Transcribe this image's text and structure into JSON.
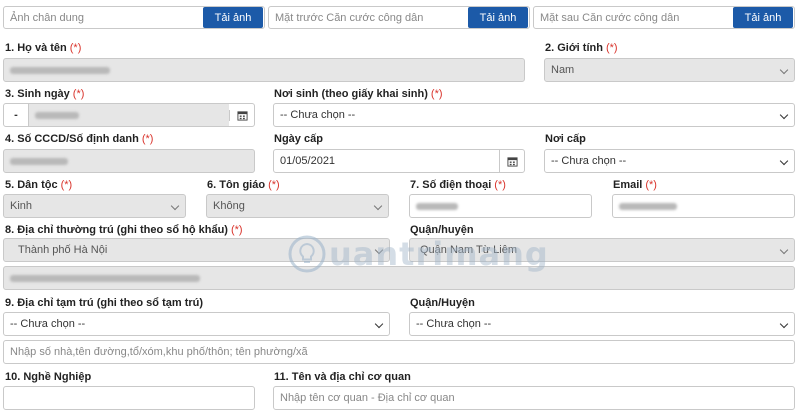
{
  "uploads": [
    {
      "placeholder": "Ảnh chân dung",
      "button": "Tải ảnh"
    },
    {
      "placeholder": "Mặt trước Căn cước công dân",
      "button": "Tải ảnh"
    },
    {
      "placeholder": "Mặt sau Căn cước công dân",
      "button": "Tải ảnh"
    }
  ],
  "required_mark": "(*)",
  "labels": {
    "full_name": "1. Họ và tên",
    "gender": "2. Giới tính",
    "dob": "3. Sinh ngày",
    "birthplace": "Nơi sinh (theo giấy khai sinh)",
    "id_number": "4. Số CCCD/Số định danh",
    "issue_date": "Ngày cấp",
    "issue_place": "Nơi cấp",
    "ethnicity": "5. Dân tộc",
    "religion": "6. Tôn giáo",
    "phone": "7. Số điện thoại",
    "email": "Email",
    "permanent_address": "8. Địa chỉ thường trú (ghi theo sổ hộ khẩu)",
    "district": "Quận/huyện",
    "temporary_address": "9. Địa chỉ tạm trú (ghi theo sổ tạm trú)",
    "district_temp": "Quận/Huyện",
    "occupation": "10. Nghề Nghiệp",
    "workplace": "11. Tên và địa chỉ cơ quan"
  },
  "values": {
    "gender": "Nam",
    "dob_prefix": "-",
    "birthplace": "-- Chưa chọn --",
    "issue_date": "01/05/2021",
    "issue_place": "-- Chưa chọn --",
    "ethnicity": "Kinh",
    "religion": "Không",
    "province": "Thành phố Hà Nội",
    "district": "Quận Nam Từ Liêm",
    "temp_province": "-- Chưa chọn --",
    "temp_district": "-- Chưa chọn --"
  },
  "placeholders": {
    "temp_address_detail": "Nhập số nhà,tên đường,tổ/xóm,khu phố/thôn; tên phường/xã",
    "workplace": "Nhập tên cơ quan - Địa chỉ cơ quan"
  },
  "watermark": {
    "text": "uantrimang"
  },
  "icons": {
    "calendar": "calendar-icon",
    "dropdown": "chevron-down-icon",
    "watermark": "lightbulb-logo-icon"
  }
}
